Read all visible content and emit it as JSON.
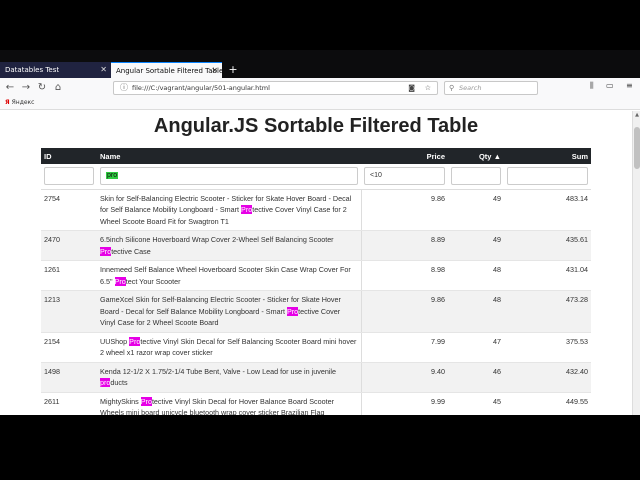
{
  "browser": {
    "tabs": [
      {
        "label": "Datatables Test",
        "active": false
      },
      {
        "label": "Angular Sortable Filtered Table",
        "active": true
      }
    ],
    "url": "file:///C:/vagrant/angular/501-angular.html",
    "search_placeholder": "Search",
    "bookmark": "Яндекс"
  },
  "page": {
    "title": "Angular.JS Sortable Filtered Table"
  },
  "table": {
    "headers": {
      "id": "ID",
      "name": "Name",
      "price": "Price",
      "qty": "Qty",
      "sum": "Sum"
    },
    "sort_indicator": "▲",
    "filters": {
      "name": "pro",
      "price": "<10"
    },
    "rows": [
      {
        "id": "2754",
        "name_parts": [
          "Skin for Self-Balancing Electric Scooter - Sticker for Skate Hover Board - Decal for Self Balance Mobility Longboard - Smart ",
          "Pro",
          "tective Cover Vinyl Case for 2 Wheel Scoote Board Fit for Swagtron T1"
        ],
        "price": "9.86",
        "qty": "49",
        "sum": "483.14"
      },
      {
        "id": "2470",
        "name_parts": [
          "6.5inch Silicone Hoverboard Wrap Cover 2-Wheel Self Balancing Scooter ",
          "Pro",
          "tective Case"
        ],
        "price": "8.89",
        "qty": "49",
        "sum": "435.61"
      },
      {
        "id": "1261",
        "name_parts": [
          "Innemeed Self Balance Wheel Hoverboard Scooter Skin Case Wrap Cover For 6.5\" ",
          "Pro",
          "tect Your Scooter"
        ],
        "price": "8.98",
        "qty": "48",
        "sum": "431.04"
      },
      {
        "id": "1213",
        "name_parts": [
          "GameXcel Skin for Self-Balancing Electric Scooter - Sticker for Skate Hover Board - Decal for Self Balance Mobility Longboard - Smart ",
          "Pro",
          "tective Cover Vinyl Case for 2 Wheel Scoote Board"
        ],
        "price": "9.86",
        "qty": "48",
        "sum": "473.28"
      },
      {
        "id": "2154",
        "name_parts": [
          "UUShop ",
          "Pro",
          "tective Vinyl Skin Decal for Self Balancing Scooter Board mini hover 2 wheel x1 razor wrap cover sticker"
        ],
        "price": "7.99",
        "qty": "47",
        "sum": "375.53"
      },
      {
        "id": "1498",
        "name_parts": [
          "Kenda 12-1/2 X 1.75/2-1/4 Tube Bent, Valve - Low Lead for use in juvenile ",
          "pro",
          "ducts"
        ],
        "price": "9.40",
        "qty": "46",
        "sum": "432.40"
      },
      {
        "id": "2611",
        "name_parts": [
          "MightySkins ",
          "Pro",
          "tective Vinyl Skin Decal for Hover Balance Board Scooter Wheels mini board unicycle bluetooth wrap cover sticker Brazilian Flag"
        ],
        "price": "9.99",
        "qty": "45",
        "sum": "449.55"
      }
    ]
  },
  "colors": {
    "header_bg": "#212529",
    "highlight": "#e600e6",
    "filter_highlight": "#2ecc40",
    "tab_accent": "#0a84ff"
  }
}
